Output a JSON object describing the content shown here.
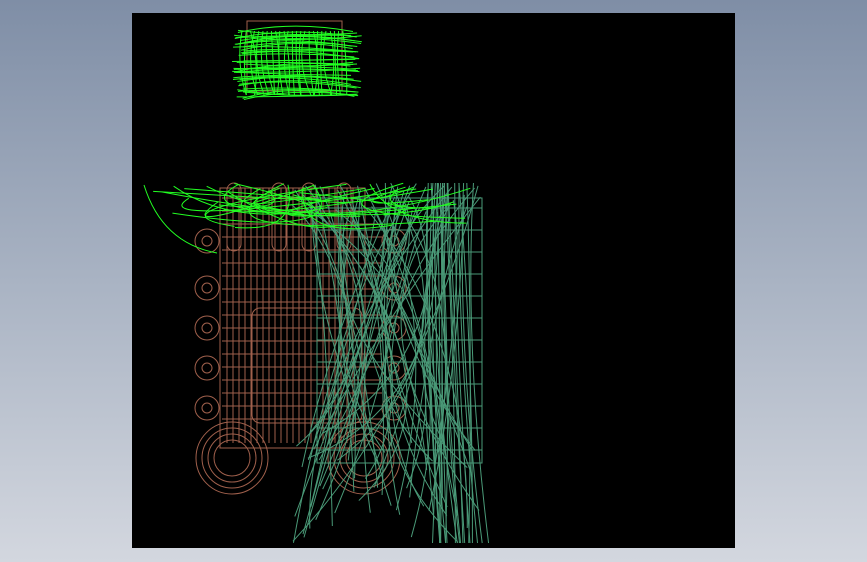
{
  "viewport": {
    "background_color": "#000000",
    "page_background_top": "#7f8ea6",
    "page_background_bottom": "#d3d7df"
  },
  "colors": {
    "part_outline": "#a0604c",
    "surface_wire_bright": "#22ff22",
    "surface_wire_teal": "#4a9a78"
  }
}
